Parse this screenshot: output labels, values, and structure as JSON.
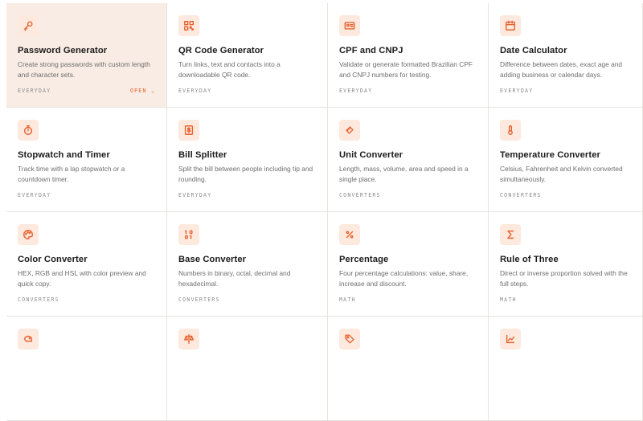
{
  "colors": {
    "accent": "#e7632f",
    "icon_bg": "#fde9de",
    "active_bg": "#f8ece4"
  },
  "open_label": "OPEN ⌄",
  "cards": [
    {
      "title": "Password Generator",
      "desc": "Create strong passwords with custom length and character sets.",
      "tag": "EVERYDAY",
      "icon": "key-icon"
    },
    {
      "title": "QR Code Generator",
      "desc": "Turn links, text and contacts into a downloadable QR code.",
      "tag": "EVERYDAY",
      "icon": "qr-code-icon"
    },
    {
      "title": "CPF and CNPJ",
      "desc": "Validate or generate formatted Brazilian CPF and CNPJ numbers for testing.",
      "tag": "EVERYDAY",
      "icon": "id-card-icon"
    },
    {
      "title": "Date Calculator",
      "desc": "Difference between dates, exact age and adding business or calendar days.",
      "tag": "EVERYDAY",
      "icon": "calendar-icon"
    },
    {
      "title": "Stopwatch and Timer",
      "desc": "Track time with a lap stopwatch or a countdown timer.",
      "tag": "EVERYDAY",
      "icon": "stopwatch-icon"
    },
    {
      "title": "Bill Splitter",
      "desc": "Split the bill between people including tip and rounding.",
      "tag": "EVERYDAY",
      "icon": "receipt-icon"
    },
    {
      "title": "Unit Converter",
      "desc": "Length, mass, volume, area and speed in a single place.",
      "tag": "CONVERTERS",
      "icon": "ruler-icon"
    },
    {
      "title": "Temperature Converter",
      "desc": "Celsius, Fahrenheit and Kelvin converted simultaneously.",
      "tag": "CONVERTERS",
      "icon": "thermometer-icon"
    },
    {
      "title": "Color Converter",
      "desc": "HEX, RGB and HSL with color preview and quick copy.",
      "tag": "CONVERTERS",
      "icon": "palette-icon"
    },
    {
      "title": "Base Converter",
      "desc": "Numbers in binary, octal, decimal and hexadecimal.",
      "tag": "CONVERTERS",
      "icon": "binary-icon"
    },
    {
      "title": "Percentage",
      "desc": "Four percentage calculations: value, share, increase and discount.",
      "tag": "MATH",
      "icon": "percent-icon"
    },
    {
      "title": "Rule of Three",
      "desc": "Direct or inverse proportion solved with the full steps.",
      "tag": "MATH",
      "icon": "sigma-icon"
    }
  ],
  "partial_icons": [
    "piggy-bank-icon",
    "scale-icon",
    "tag-icon",
    "chart-icon"
  ]
}
